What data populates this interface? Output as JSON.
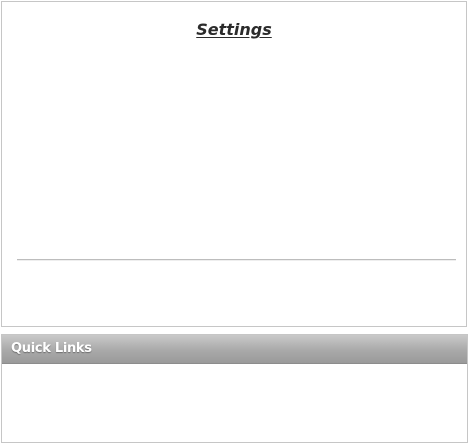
{
  "settings": {
    "title": "Settings"
  },
  "quick_links": {
    "title": "Quick Links"
  }
}
